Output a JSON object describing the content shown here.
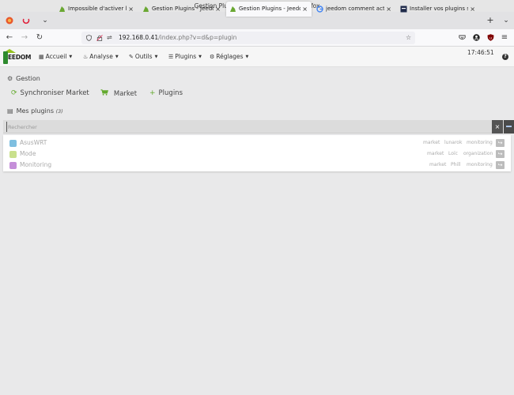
{
  "window": {
    "title": "Gestion Plugins - Jeedom — Mozilla Firefox"
  },
  "tabs": [
    {
      "label": "Impossible d'activer les pl",
      "active": false
    },
    {
      "label": "Gestion Plugins - Jeedom",
      "active": false
    },
    {
      "label": "Gestion Plugins - Jeedom",
      "active": true
    },
    {
      "label": "jeedom comment activer",
      "active": false
    },
    {
      "label": "Installer vos plugins sur Je",
      "active": false
    }
  ],
  "browser": {
    "url_host": "192.168.0.41",
    "url_path": "/index.php?v=d&p=plugin",
    "new_tab": "+",
    "close": "×"
  },
  "header": {
    "logo_text": "EEDOM",
    "menu": [
      {
        "label": "Accueil",
        "icon": "dashboard-icon"
      },
      {
        "label": "Analyse",
        "icon": "analysis-icon"
      },
      {
        "label": "Outils",
        "icon": "wrench-icon"
      },
      {
        "label": "Plugins",
        "icon": "list-icon"
      },
      {
        "label": "Réglages",
        "icon": "gears-icon"
      }
    ],
    "time": "17:46:51",
    "help": "?"
  },
  "gestion": {
    "title": "Gestion",
    "actions": [
      {
        "label": "Synchroniser Market",
        "icon": "sync-icon"
      },
      {
        "label": "Market",
        "icon": "cart-icon"
      },
      {
        "label": "Plugins",
        "icon": "plus-icon"
      }
    ]
  },
  "mes_plugins": {
    "title": "Mes plugins",
    "count": "(3)",
    "search_placeholder": "Rechercher",
    "clear": "×",
    "plugins": [
      {
        "name": "AsusWRT",
        "source": "market",
        "author": "lunarok",
        "category": "monitoring",
        "icon_color": "#7fbfe0"
      },
      {
        "name": "Mode",
        "source": "market",
        "author": "Loïc",
        "category": "organization",
        "icon_color": "#c9e08c"
      },
      {
        "name": "Monitoring",
        "source": "market",
        "author": "Phill",
        "category": "monitoring",
        "icon_color": "#c58fd9"
      }
    ]
  }
}
